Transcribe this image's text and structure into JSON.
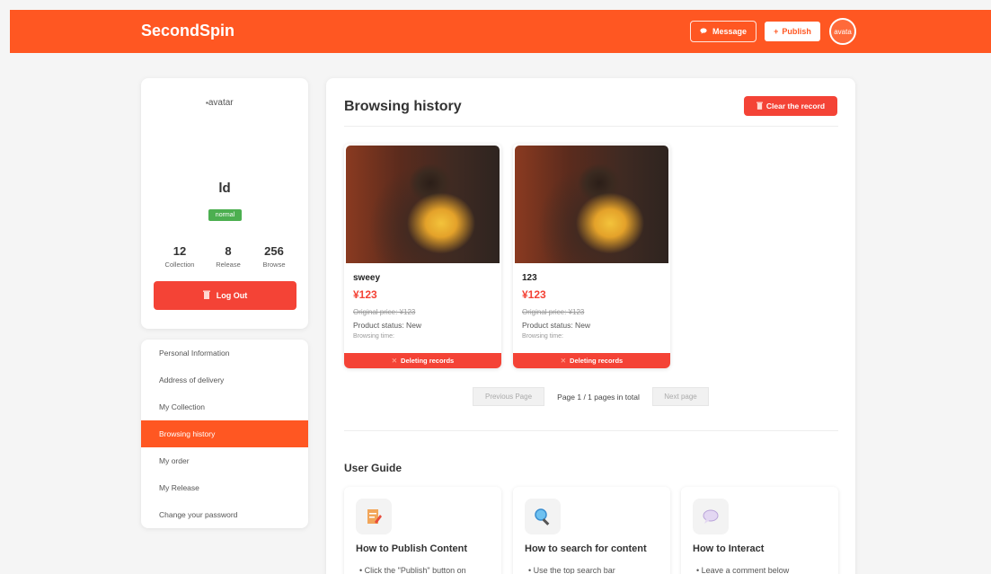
{
  "header": {
    "brand": "SecondSpin",
    "message_label": "Message",
    "publish_label": "Publish",
    "avatar_alt": "avata",
    "color": "#ff5722"
  },
  "profile": {
    "avatar_alt": "avatar",
    "username": "ld",
    "badge": "normal",
    "stats": [
      {
        "value": "12",
        "label": "Collection"
      },
      {
        "value": "8",
        "label": "Release"
      },
      {
        "value": "256",
        "label": "Browse"
      }
    ],
    "logout_label": "Log Out"
  },
  "menu": {
    "items": [
      {
        "label": "Personal Information"
      },
      {
        "label": "Address of delivery"
      },
      {
        "label": "My Collection"
      },
      {
        "label": "Browsing history"
      },
      {
        "label": "My order"
      },
      {
        "label": "My Release"
      },
      {
        "label": "Change your password"
      }
    ],
    "active": "Browsing history"
  },
  "main": {
    "title": "Browsing history",
    "clear_label": "Clear the record",
    "products": [
      {
        "name": "sweey",
        "price": "¥123",
        "original": "Original price: ¥123",
        "status": "Product status: New",
        "time": "Browsing time:",
        "delete_label": "Deleting records"
      },
      {
        "name": "123",
        "price": "¥123",
        "original": "Original price: ¥123",
        "status": "Product status: New",
        "time": "Browsing time:",
        "delete_label": "Deleting records"
      }
    ],
    "pager": {
      "prev": "Previous Page",
      "info": "Page 1 / 1 pages in total",
      "next": "Next page"
    }
  },
  "guide": {
    "title": "User Guide",
    "cards": [
      {
        "icon": "pencil-note-icon",
        "title": "How to Publish Content",
        "text": "Click the \"Publish\" button on"
      },
      {
        "icon": "magnifier-icon",
        "title": "How to search for content",
        "text": "Use the top search bar"
      },
      {
        "icon": "speech-bubble-icon",
        "title": "How to Interact",
        "text": "Leave a comment below"
      }
    ]
  }
}
